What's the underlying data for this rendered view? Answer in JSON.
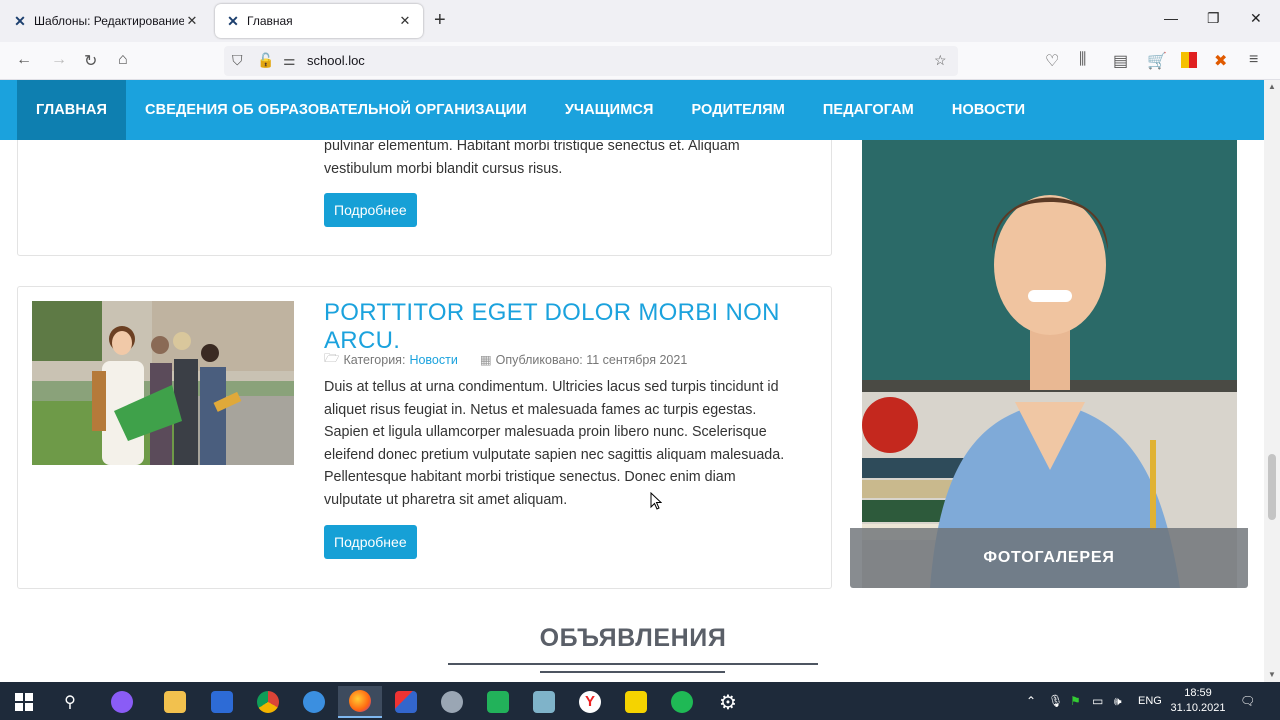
{
  "browser": {
    "tabs": [
      {
        "title": "Шаблоны: Редактирование стиля"
      },
      {
        "title": "Главная"
      }
    ],
    "url": "school.loc"
  },
  "site": {
    "menu": [
      "ГЛАВНАЯ",
      "СВЕДЕНИЯ ОБ ОБРАЗОВАТЕЛЬНОЙ ОРГАНИЗАЦИИ",
      "УЧАЩИМСЯ",
      "РОДИТЕЛЯМ",
      "ПЕДАГОГАМ",
      "НОВОСТИ"
    ],
    "article1": {
      "text_lines": [
        "pulvinar elementum. Habitant morbi tristique senectus et. Aliquam",
        "vestibulum morbi blandit cursus risus."
      ],
      "button": "Подробнее"
    },
    "article2": {
      "title": "PORTTITOR EGET DOLOR MORBI NON ARCU.",
      "category_label": "Категория:",
      "category_link": "Новости",
      "published": "Опубликовано: 11 сентября 2021",
      "text_lines": [
        "Duis at tellus at urna condimentum. Ultricies lacus sed turpis tincidunt id",
        "aliquet risus feugiat in. Netus et malesuada fames ac turpis egestas.",
        "Sapien et ligula ullamcorper malesuada proin libero nunc. Scelerisque",
        "eleifend donec pretium vulputate sapien nec sagittis aliquam malesuada.",
        "Pellentesque habitant morbi tristique senectus. Donec enim diam",
        "vulputate ut pharetra sit amet aliquam."
      ],
      "button": "Подробнее"
    },
    "gallery": {
      "caption": "ФОТОГАЛЕРЕЯ"
    },
    "section_title": "ОБЪЯВЛЕНИЯ",
    "colors": {
      "accent": "#1ba2dd",
      "menu_active": "#0e7fb0"
    }
  },
  "taskbar": {
    "lang": "ENG",
    "time": "18:59",
    "date": "31.10.2021"
  }
}
